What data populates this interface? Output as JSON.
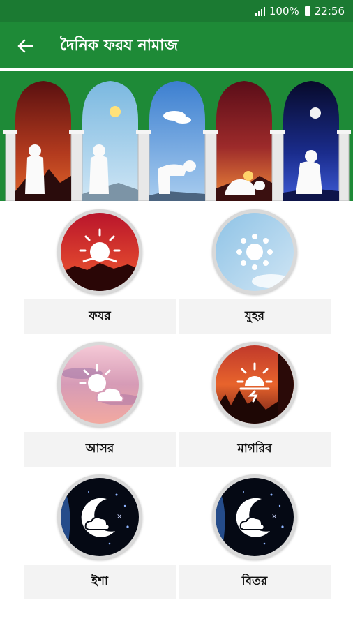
{
  "status_bar": {
    "battery": "100%",
    "time": "22:56"
  },
  "app_bar": {
    "title": "দৈনিক ফরয নামাজ"
  },
  "prayers": [
    {
      "label": "ফযর"
    },
    {
      "label": "যুহর"
    },
    {
      "label": "আসর"
    },
    {
      "label": "মাগরিব"
    },
    {
      "label": "ইশা"
    },
    {
      "label": "বিতর"
    }
  ]
}
